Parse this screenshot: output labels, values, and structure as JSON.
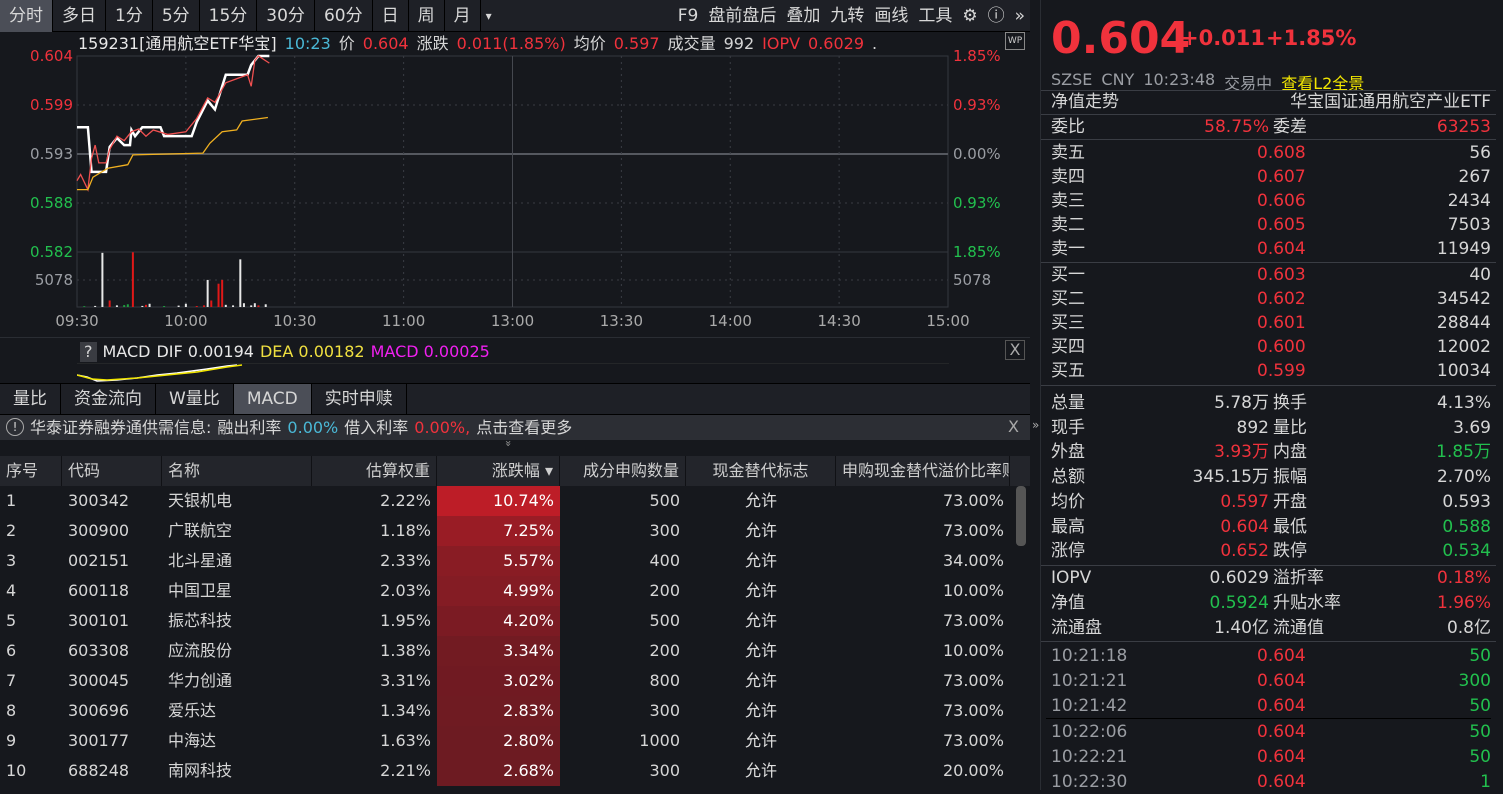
{
  "toolbar": {
    "periods": [
      "分时",
      "多日",
      "1分",
      "5分",
      "15分",
      "30分",
      "60分",
      "日",
      "周",
      "月"
    ],
    "active": "分时",
    "more": "▾",
    "right": [
      "F9",
      "盘前盘后",
      "叠加",
      "九转",
      "画线",
      "工具"
    ]
  },
  "info": {
    "title": "159231[通用航空ETF华宝]",
    "time": "10:23",
    "price_label": "价",
    "price": "0.604",
    "chg_label": "涨跌",
    "chg": "0.011(1.85%)",
    "avg_label": "均价",
    "avg": "0.597",
    "vol_label": "成交量",
    "vol": "992",
    "iopv_label": "IOPV",
    "iopv": "0.6029",
    "dot": ".",
    "wp": "WP"
  },
  "chart_data": {
    "type": "line",
    "title": "分时",
    "y_left": [
      {
        "t": "0.604",
        "c": "red"
      },
      {
        "t": "0.599",
        "c": "red"
      },
      {
        "t": "0.593",
        "c": "grey"
      },
      {
        "t": "0.588",
        "c": "green"
      },
      {
        "t": "0.582",
        "c": "green"
      }
    ],
    "y_right": [
      {
        "t": "1.85%",
        "c": "red"
      },
      {
        "t": "0.93%",
        "c": "red"
      },
      {
        "t": "0.00%",
        "c": "grey"
      },
      {
        "t": "0.93%",
        "c": "green"
      },
      {
        "t": "1.85%",
        "c": "green"
      }
    ],
    "vol_label": "5078",
    "xticks": [
      "09:30",
      "10:00",
      "10:30",
      "11:00",
      "13:00",
      "13:30",
      "14:00",
      "14:30",
      "15:00"
    ],
    "ylim": [
      0.582,
      0.604
    ],
    "prev_close": 0.593,
    "vol_max": 10156,
    "minutes_total": 240,
    "series": [
      {
        "name": "price",
        "color": "#ffffff",
        "points": [
          [
            0,
            0.596
          ],
          [
            3,
            0.596
          ],
          [
            4,
            0.591
          ],
          [
            8,
            0.591
          ],
          [
            9,
            0.5938
          ],
          [
            11,
            0.5948
          ],
          [
            13,
            0.594
          ],
          [
            14.6,
            0.594
          ],
          [
            15,
            0.5957
          ],
          [
            16,
            0.595
          ],
          [
            18,
            0.596
          ],
          [
            23,
            0.596
          ],
          [
            24,
            0.595
          ],
          [
            31.6,
            0.595
          ],
          [
            33,
            0.5966
          ],
          [
            36,
            0.599
          ],
          [
            38,
            0.598
          ],
          [
            41,
            0.6019
          ],
          [
            47,
            0.6019
          ],
          [
            48,
            0.603
          ],
          [
            50,
            0.604
          ],
          [
            53,
            0.604
          ]
        ]
      },
      {
        "name": "iopv",
        "color": "#f05050",
        "points": [
          [
            0,
            0.59
          ],
          [
            1,
            0.5907
          ],
          [
            3,
            0.589
          ],
          [
            4,
            0.5925
          ],
          [
            5,
            0.594
          ],
          [
            6,
            0.592
          ],
          [
            8,
            0.592
          ],
          [
            9,
            0.5935
          ],
          [
            11,
            0.595
          ],
          [
            13,
            0.5945
          ],
          [
            15,
            0.5955
          ],
          [
            17,
            0.5958
          ],
          [
            19,
            0.595
          ],
          [
            21,
            0.5957
          ],
          [
            25,
            0.5952
          ],
          [
            30,
            0.5955
          ],
          [
            33,
            0.597
          ],
          [
            36,
            0.5993
          ],
          [
            38,
            0.5988
          ],
          [
            41,
            0.601
          ],
          [
            47,
            0.6019
          ],
          [
            48,
            0.6006
          ],
          [
            49,
            0.6035
          ],
          [
            50,
            0.604
          ],
          [
            53,
            0.6032
          ]
        ]
      },
      {
        "name": "avg",
        "color": "#f0b020",
        "points": [
          [
            0,
            0.589
          ],
          [
            3,
            0.589
          ],
          [
            4.4,
            0.5904
          ],
          [
            8.5,
            0.5914
          ],
          [
            14,
            0.5918
          ],
          [
            15.4,
            0.5929
          ],
          [
            34.7,
            0.5931
          ],
          [
            36.6,
            0.5942
          ],
          [
            40,
            0.5955
          ],
          [
            44,
            0.5957
          ],
          [
            45.5,
            0.5967
          ],
          [
            52.6,
            0.5971
          ]
        ]
      }
    ],
    "volume": [
      [
        2,
        150,
        "g"
      ],
      [
        5,
        200,
        "w"
      ],
      [
        7,
        10000,
        "w"
      ],
      [
        9,
        1200,
        "r"
      ],
      [
        11,
        300,
        "w"
      ],
      [
        13,
        350,
        "g"
      ],
      [
        14,
        500,
        "g"
      ],
      [
        15.4,
        10100,
        "r"
      ],
      [
        18,
        200,
        "w"
      ],
      [
        19,
        400,
        "r"
      ],
      [
        20,
        600,
        "w"
      ],
      [
        24,
        180,
        "g"
      ],
      [
        28,
        260,
        "w"
      ],
      [
        30,
        600,
        "w"
      ],
      [
        33,
        180,
        "r"
      ],
      [
        35,
        300,
        "r"
      ],
      [
        36,
        5000,
        "w"
      ],
      [
        37,
        1200,
        "r"
      ],
      [
        39,
        4300,
        "r"
      ],
      [
        40,
        5000,
        "r"
      ],
      [
        41,
        400,
        "w"
      ],
      [
        43,
        300,
        "w"
      ],
      [
        45,
        8800,
        "w"
      ],
      [
        46,
        700,
        "w"
      ],
      [
        48,
        300,
        "w"
      ],
      [
        49,
        700,
        "w"
      ],
      [
        50,
        300,
        "r"
      ],
      [
        52,
        500,
        "w"
      ]
    ]
  },
  "macd": {
    "q": "?",
    "name": "MACD",
    "dif": "DIF 0.00194",
    "dea": "DEA 0.00182",
    "macd": "MACD 0.00025",
    "close": "X"
  },
  "tabs": [
    "量比",
    "资金流向",
    "W量比",
    "MACD",
    "实时申赎"
  ],
  "active_tab": "MACD",
  "notice": {
    "icon": "!",
    "text": "华泰证券融券通供需信息:",
    "lend_label": "融出利率",
    "lend": "0.00%",
    "borrow_label": "借入利率",
    "borrow": "0.00%,",
    "more": "点击查看更多",
    "close": "X",
    "expand": "»"
  },
  "table": {
    "headers": [
      "序号",
      "代码",
      "名称",
      "估算权重",
      "涨跌幅 ▾",
      "成分申购数量",
      "现金替代标志",
      "申购现金替代溢价比率赎"
    ],
    "rows": [
      [
        "1",
        "300342",
        "天银机电",
        "2.22%",
        "10.74%",
        "500",
        "允许",
        "73.00%"
      ],
      [
        "2",
        "300900",
        "广联航空",
        "1.18%",
        "7.25%",
        "300",
        "允许",
        "73.00%"
      ],
      [
        "3",
        "002151",
        "北斗星通",
        "2.33%",
        "5.57%",
        "400",
        "允许",
        "34.00%"
      ],
      [
        "4",
        "600118",
        "中国卫星",
        "2.03%",
        "4.99%",
        "200",
        "允许",
        "10.00%"
      ],
      [
        "5",
        "300101",
        "振芯科技",
        "1.95%",
        "4.20%",
        "500",
        "允许",
        "73.00%"
      ],
      [
        "6",
        "603308",
        "应流股份",
        "1.38%",
        "3.34%",
        "200",
        "允许",
        "10.00%"
      ],
      [
        "7",
        "300045",
        "华力创通",
        "3.31%",
        "3.02%",
        "800",
        "允许",
        "73.00%"
      ],
      [
        "8",
        "300696",
        "爱乐达",
        "1.34%",
        "2.83%",
        "300",
        "允许",
        "73.00%"
      ],
      [
        "9",
        "300177",
        "中海达",
        "1.63%",
        "2.80%",
        "1000",
        "允许",
        "73.00%"
      ],
      [
        "10",
        "688248",
        "南网科技",
        "2.21%",
        "2.68%",
        "300",
        "允许",
        "20.00%"
      ]
    ]
  },
  "quote": {
    "price": "0.604",
    "chg": "+0.011",
    "pct": "+1.85%",
    "exchange": "SZSE",
    "currency": "CNY",
    "time": "10:23:48",
    "status": "交易中",
    "l2": "查看L2全景",
    "nav_trend": "净值走势",
    "fund_name": "华宝国证通用航空产业ETF",
    "wb_label": "委比",
    "wb": "58.75%",
    "wc_label": "委差",
    "wc": "63253",
    "asks": [
      [
        "卖五",
        "0.608",
        "56"
      ],
      [
        "卖四",
        "0.607",
        "267"
      ],
      [
        "卖三",
        "0.606",
        "2434"
      ],
      [
        "卖二",
        "0.605",
        "7503"
      ],
      [
        "卖一",
        "0.604",
        "11949"
      ]
    ],
    "bids": [
      [
        "买一",
        "0.603",
        "40"
      ],
      [
        "买二",
        "0.602",
        "34542"
      ],
      [
        "买三",
        "0.601",
        "28844"
      ],
      [
        "买四",
        "0.600",
        "12002"
      ],
      [
        "买五",
        "0.599",
        "10034"
      ]
    ],
    "stats": [
      [
        "总量",
        "5.78万",
        "",
        "换手",
        "4.13%",
        ""
      ],
      [
        "现手",
        "892",
        "",
        "量比",
        "3.69",
        ""
      ],
      [
        "外盘",
        "3.93万",
        "red",
        "内盘",
        "1.85万",
        "green"
      ],
      [
        "总额",
        "345.15万",
        "",
        "振幅",
        "2.70%",
        ""
      ],
      [
        "均价",
        "0.597",
        "red",
        "开盘",
        "0.593",
        ""
      ],
      [
        "最高",
        "0.604",
        "red",
        "最低",
        "0.588",
        "green"
      ],
      [
        "涨停",
        "0.652",
        "red",
        "跌停",
        "0.534",
        "green"
      ]
    ],
    "fund": [
      [
        "IOPV",
        "0.6029",
        "",
        "溢折率",
        "0.18%",
        "red"
      ],
      [
        "净值",
        "0.5924",
        "green",
        "升贴水率",
        "1.96%",
        "red"
      ],
      [
        "流通盘",
        "1.40亿",
        "",
        "流通值",
        "0.8亿",
        ""
      ]
    ],
    "trades": [
      [
        "10:21:18",
        "0.604",
        "50"
      ],
      [
        "10:21:21",
        "0.604",
        "300"
      ],
      [
        "10:21:42",
        "0.604",
        "50"
      ],
      [
        "10:22:06",
        "0.604",
        "50"
      ],
      [
        "10:22:21",
        "0.604",
        "50"
      ],
      [
        "10:22:30",
        "0.604",
        "1"
      ]
    ]
  },
  "colors": {
    "red": "#f0323c",
    "green": "#22c04e",
    "yellow": "#f2e600",
    "bg": "#16181d"
  }
}
